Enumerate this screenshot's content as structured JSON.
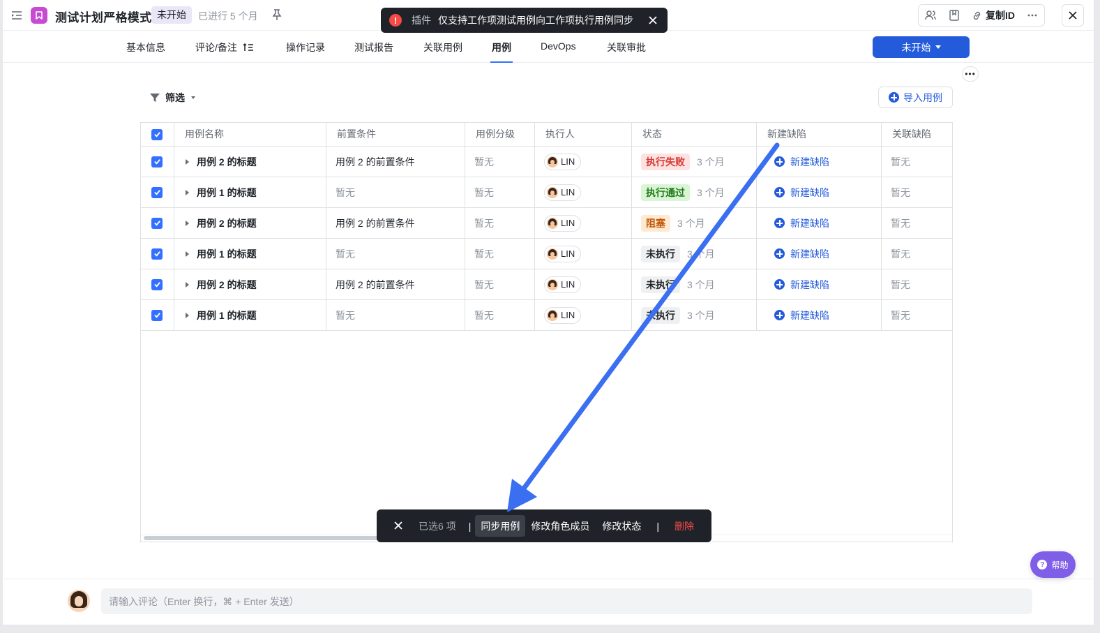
{
  "header": {
    "title": "测试计划严格模式",
    "status_tag": "未开始",
    "elapsed": "已进行 5 个月",
    "copy_id_label": "复制ID"
  },
  "toast": {
    "plugin_label": "插件",
    "message": "仅支持工作项测试用例向工作项执行用例同步"
  },
  "tabs": [
    {
      "label": "基本信息"
    },
    {
      "label": "评论/备注"
    },
    {
      "label": "操作记录"
    },
    {
      "label": "测试报告"
    },
    {
      "label": "关联用例"
    },
    {
      "label": "用例",
      "active": true
    },
    {
      "label": "DevOps"
    },
    {
      "label": "关联审批"
    }
  ],
  "status_button": "未开始",
  "filter_label": "筛选",
  "import_label": "导入用例",
  "table": {
    "columns": [
      "用例名称",
      "前置条件",
      "用例分级",
      "执行人",
      "状态",
      "新建缺陷",
      "关联缺陷"
    ],
    "rows": [
      {
        "name": "用例 2 的标题",
        "precondition": "用例 2 的前置条件",
        "pre_muted": false,
        "level": "暂无",
        "executor": "LIN",
        "status": "执行失败",
        "status_type": "fail",
        "time": "3 个月",
        "new_defect": "新建缺陷",
        "linked": "暂无"
      },
      {
        "name": "用例 1 的标题",
        "precondition": "暂无",
        "pre_muted": true,
        "level": "暂无",
        "executor": "LIN",
        "status": "执行通过",
        "status_type": "pass",
        "time": "3 个月",
        "new_defect": "新建缺陷",
        "linked": "暂无"
      },
      {
        "name": "用例 2 的标题",
        "precondition": "用例 2 的前置条件",
        "pre_muted": false,
        "level": "暂无",
        "executor": "LIN",
        "status": "阻塞",
        "status_type": "block",
        "time": "3 个月",
        "new_defect": "新建缺陷",
        "linked": "暂无"
      },
      {
        "name": "用例 1 的标题",
        "precondition": "暂无",
        "pre_muted": true,
        "level": "暂无",
        "executor": "LIN",
        "status": "未执行",
        "status_type": "none",
        "time": "3 个月",
        "new_defect": "新建缺陷",
        "linked": "暂无"
      },
      {
        "name": "用例 2 的标题",
        "precondition": "用例 2 的前置条件",
        "pre_muted": false,
        "level": "暂无",
        "executor": "LIN",
        "status": "未执行",
        "status_type": "none",
        "time": "3 个月",
        "new_defect": "新建缺陷",
        "linked": "暂无"
      },
      {
        "name": "用例 1 的标题",
        "precondition": "暂无",
        "pre_muted": true,
        "level": "暂无",
        "executor": "LIN",
        "status": "未执行",
        "status_type": "none",
        "time": "3 个月",
        "new_defect": "新建缺陷",
        "linked": "暂无"
      }
    ]
  },
  "action_bar": {
    "count": "已选6 项",
    "separator": "|",
    "sync": "同步用例",
    "edit_members": "修改角色成员",
    "edit_status": "修改状态",
    "delete": "删除"
  },
  "help_label": "帮助",
  "comment": {
    "placeholder": "请输入评论（Enter 换行，⌘ + Enter 发送）"
  },
  "colors": {
    "primary": "#245bdb",
    "accent_blue": "#3370ff",
    "app_badge": "#c64bd1",
    "help": "#7f5fe7",
    "annotation_arrow": "#3a6ff2"
  }
}
